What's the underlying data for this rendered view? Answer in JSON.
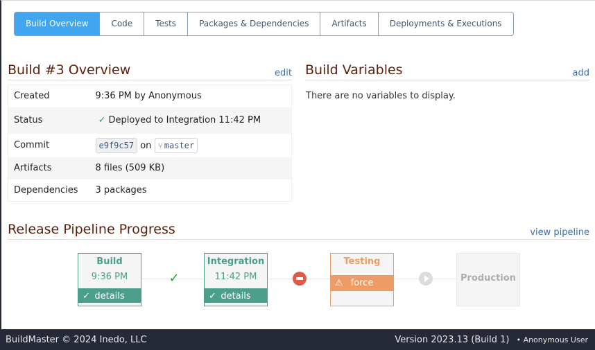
{
  "tabs": [
    {
      "label": "Build Overview",
      "active": true
    },
    {
      "label": "Code"
    },
    {
      "label": "Tests"
    },
    {
      "label": "Packages & Dependencies"
    },
    {
      "label": "Artifacts"
    },
    {
      "label": "Deployments & Executions"
    }
  ],
  "overview": {
    "title": "Build #3 Overview",
    "edit_label": "edit",
    "rows": {
      "created": {
        "label": "Created",
        "value": "9:36 PM by Anonymous"
      },
      "status": {
        "label": "Status",
        "icon": "check-icon",
        "value": "Deployed to Integration",
        "time": "11:42 PM"
      },
      "commit": {
        "label": "Commit",
        "hash": "e9f9c57",
        "on": "on",
        "branch_icon": "git-branch-icon",
        "branch": "master"
      },
      "artifacts": {
        "label": "Artifacts",
        "value": "8 files (509 KB)"
      },
      "dependencies": {
        "label": "Dependencies",
        "value": "3 packages"
      }
    }
  },
  "variables": {
    "title": "Build Variables",
    "add_label": "add",
    "empty_text": "There are no variables to display."
  },
  "pipeline": {
    "title": "Release Pipeline Progress",
    "view_label": "view pipeline",
    "stages": [
      {
        "name": "Build",
        "time": "9:36 PM",
        "action": "details",
        "status": "success"
      },
      {
        "name": "Integration",
        "time": "11:42 PM",
        "action": "details",
        "status": "success"
      },
      {
        "name": "Testing",
        "action": "force",
        "status": "warning"
      },
      {
        "name": "Production",
        "status": "pending"
      }
    ],
    "connectors": [
      "check-icon",
      "blocked-icon",
      "play-icon"
    ],
    "colors": {
      "success": "#4a9e8a",
      "warning": "#ee9c65",
      "blocked": "#e05a48",
      "pending": "#a8aeb4"
    }
  },
  "footer": {
    "copyright": "BuildMaster © 2024 Inedo, LLC",
    "version": "Version 2023.13 (Build 1)",
    "user": "• Anonymous User"
  }
}
